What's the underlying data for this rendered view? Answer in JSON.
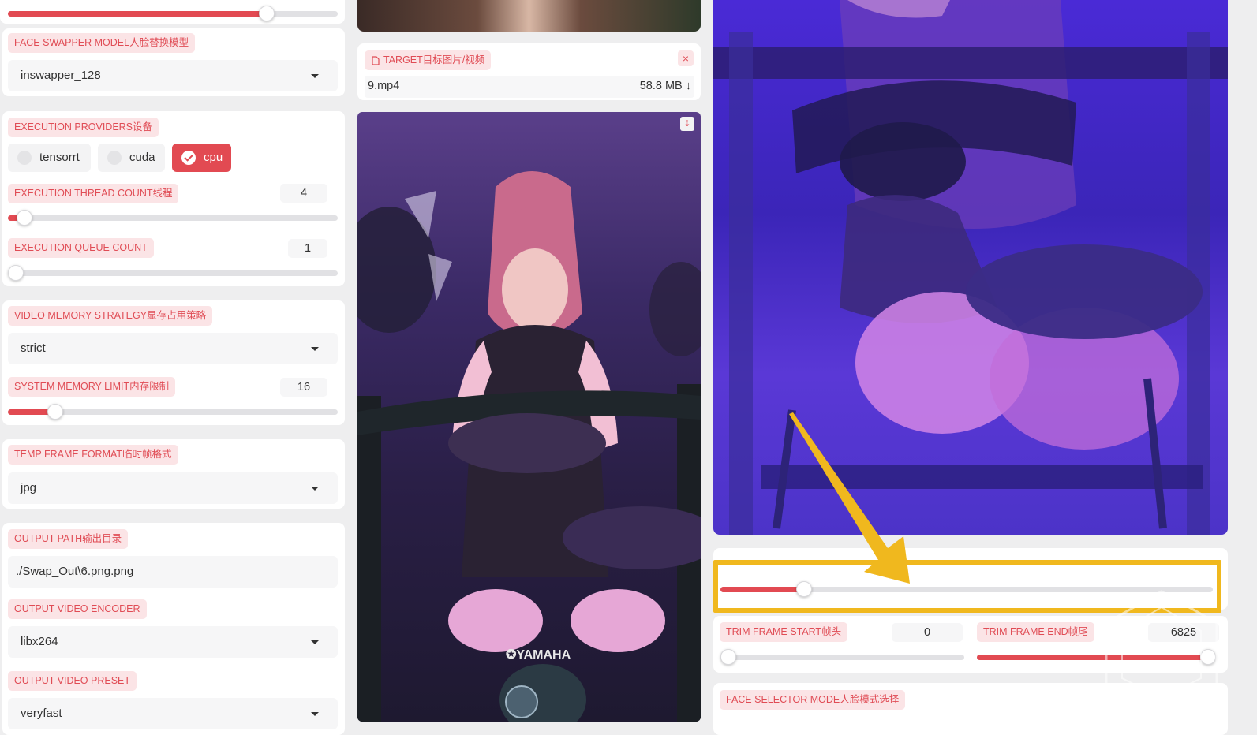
{
  "left": {
    "face_swapper_model": {
      "label": "FACE SWAPPER MODEL人脸替换模型",
      "value": "inswapper_128"
    },
    "execution_providers": {
      "label": "EXECUTION PROVIDERS设备",
      "options": [
        {
          "label": "tensorrt",
          "checked": false
        },
        {
          "label": "cuda",
          "checked": false
        },
        {
          "label": "cpu",
          "checked": true
        }
      ]
    },
    "execution_thread_count": {
      "label": "EXECUTION THREAD COUNT线程",
      "value": "4",
      "level": 0.03
    },
    "execution_queue_count": {
      "label": "EXECUTION QUEUE COUNT",
      "value": "1",
      "level": 0.0
    },
    "video_memory_strategy": {
      "label": "VIDEO MEMORY STRATEGY显存占用策略",
      "value": "strict"
    },
    "system_memory_limit": {
      "label": "SYSTEM MEMORY LIMIT内存限制",
      "value": "16",
      "level": 0.14
    },
    "temp_frame_format": {
      "label": "TEMP FRAME FORMAT临时帧格式",
      "value": "jpg"
    },
    "output_path": {
      "label": "OUTPUT PATH输出目录",
      "value": "./Swap_Out\\6.png.png"
    },
    "output_video_encoder": {
      "label": "OUTPUT VIDEO ENCODER",
      "value": "libx264"
    },
    "output_video_preset": {
      "label": "OUTPUT VIDEO PRESET",
      "value": "veryfast"
    }
  },
  "top_slider": {
    "level": 0.78
  },
  "target": {
    "label": "TARGET目标图片/视频",
    "file_name": "9.mp4",
    "file_size": "58.8 MB ↓",
    "close_icon": "×"
  },
  "right": {
    "preview_slider": {
      "level": 0.17
    },
    "trim_frame_start": {
      "label": "TRIM FRAME START帧头",
      "value": "0",
      "level": 0.0
    },
    "trim_frame_end": {
      "label": "TRIM FRAME END帧尾",
      "value": "6825",
      "level": 1.0
    },
    "face_selector_mode": {
      "label": "FACE SELECTOR MODE人脸模式选择"
    }
  },
  "colors": {
    "accent": "#e24a52",
    "badge_bg": "#fbe4e6",
    "highlight": "#f0b81e"
  }
}
